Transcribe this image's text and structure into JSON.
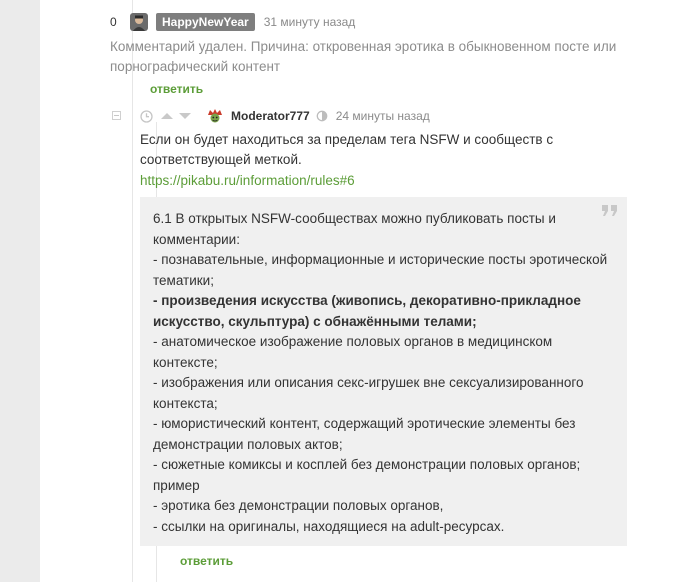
{
  "comment1": {
    "rating": "0",
    "username": "HappyNewYear",
    "time": "31 минуту назад",
    "text": "Комментарий удален. Причина: откровенная эротика в обыкновенном посте или порнографический контент",
    "reply_label": "ответить"
  },
  "comment2": {
    "username": "Moderator777",
    "time": "24 минуты назад",
    "text": "Если он будет находиться за пределам тега NSFW и сообществ с соответствующей меткой.",
    "link": "https://pikabu.ru/information/rules#6",
    "quote_lines": [
      "6.1 В открытых NSFW-сообществах можно публиковать посты и комментарии:",
      "- познавательные, информационные и исторические посты эротической тематики;",
      "- произведения искусства (живопись, декоративно-прикладное искусство, скульптура) с обнажёнными телами;",
      "- анатомическое изображение половых органов в медицинском контексте;",
      "- изображения или описания секс-игрушек вне сексуализированного контекста;",
      "- юмористический контент, содержащий эротические элементы без демонстрации половых актов;",
      "- сюжетные комиксы и косплей без демонстрации половых органов; пример",
      "- эротика без демонстрации половых органов,",
      "- ссылки на оригиналы, находящиеся на adult-ресурсах."
    ],
    "reply_label": "ответить"
  },
  "icons": {
    "clock": "clock-icon",
    "vote_up": "arrow-up-icon",
    "vote_down": "arrow-down-icon",
    "moderator": "moderator-icon",
    "quote": "quote-icon",
    "collapse": "collapse-icon"
  },
  "colors": {
    "link_green": "#5c9d38",
    "badge_gray": "#7e7e7e",
    "muted_text": "#8c8c8c",
    "quote_bg": "#f0f0f0",
    "page_bg": "#ebebeb"
  }
}
